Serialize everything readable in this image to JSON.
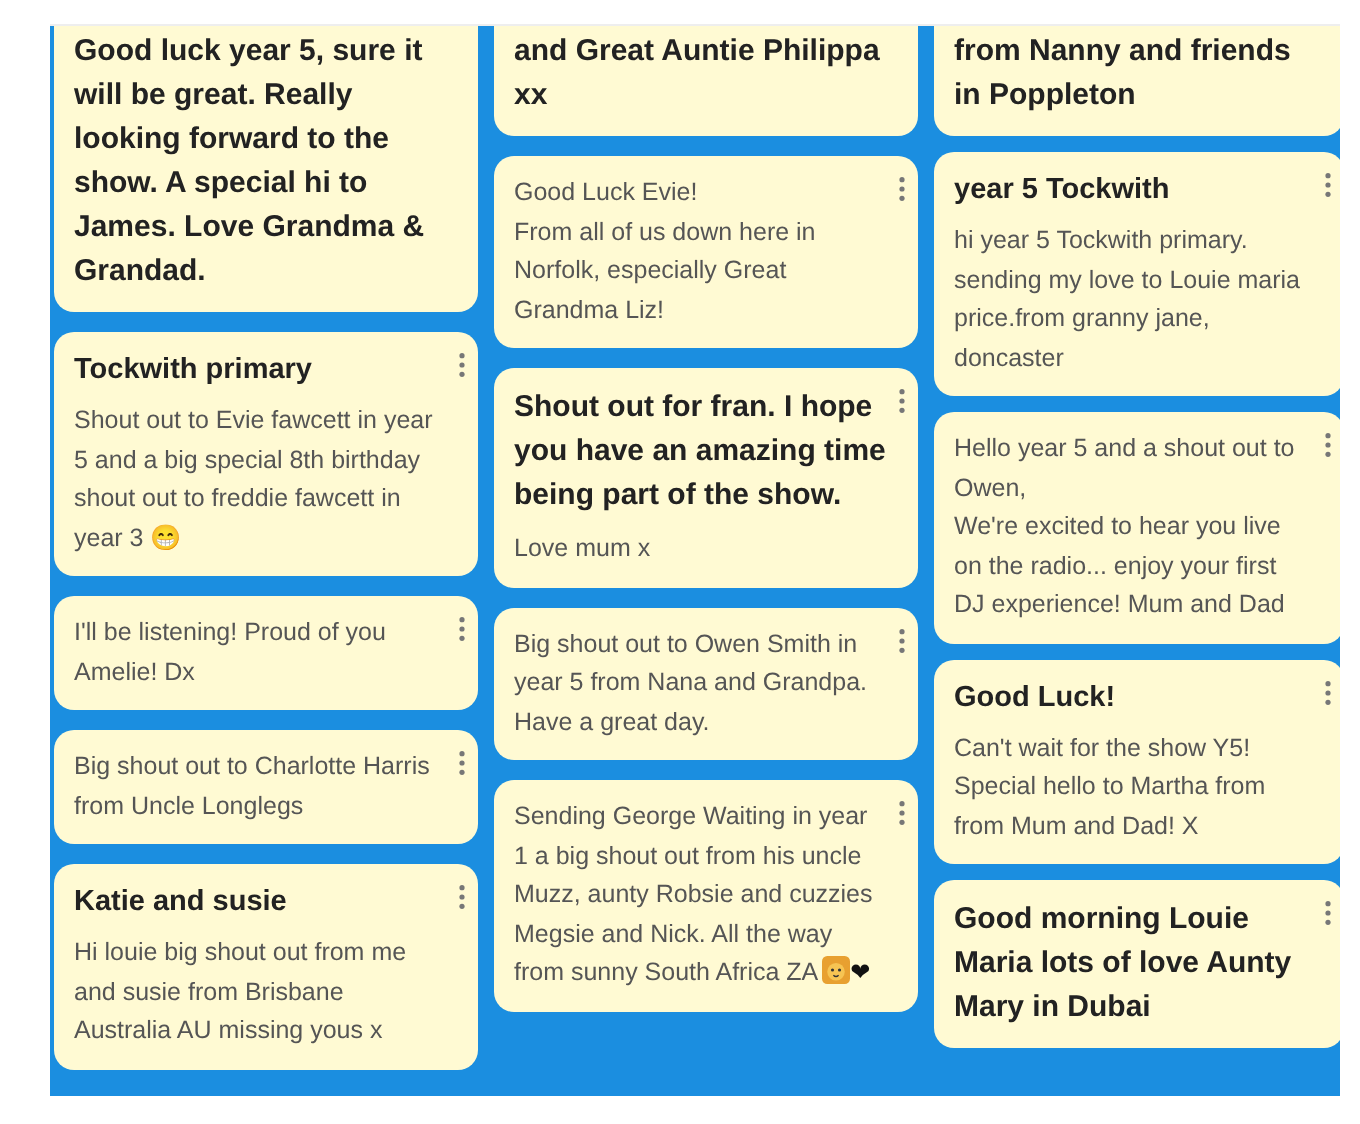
{
  "columns": [
    {
      "cards": [
        {
          "kind": "big",
          "text": "Good luck year 5, sure it will be great. Really looking forward to the show. A special hi to James. Love Grandma & Grandad."
        },
        {
          "kind": "titled",
          "title": "Tockwith primary",
          "body": "Shout out to Evie fawcett in year 5 and a big special 8th birthday shout out to freddie fawcett in year 3 😁"
        },
        {
          "kind": "plain",
          "body": "I'll be listening! Proud of you Amelie! Dx"
        },
        {
          "kind": "plain",
          "body": "Big shout out to Charlotte Harris from Uncle Longlegs"
        },
        {
          "kind": "titled",
          "title": "Katie and susie",
          "body": "Hi louie big shout out from me and susie from Brisbane Australia AU missing yous x"
        }
      ]
    },
    {
      "cards": [
        {
          "kind": "big",
          "text": "and Great Auntie Philippa xx"
        },
        {
          "kind": "plain",
          "body": "Good Luck Evie!\nFrom all of us down here in Norfolk, especially Great Grandma Liz!"
        },
        {
          "kind": "titled",
          "title": "Shout out for fran. I hope you have an amazing time being part of the show.",
          "big_title": true,
          "body": "Love mum x"
        },
        {
          "kind": "plain",
          "body": "Big shout out to Owen Smith in year 5 from Nana and Grandpa. Have a great day."
        },
        {
          "kind": "plain",
          "body": "Sending George Waiting in year 1 a big shout out from his uncle Muzz, aunty Robsie and cuzzies Megsie and Nick. All the way from sunny South Africa ZA",
          "lion": true,
          "suffix": "❤"
        }
      ]
    },
    {
      "cards": [
        {
          "kind": "big",
          "text": "from Nanny and friends in Poppleton"
        },
        {
          "kind": "titled",
          "title": "year 5 Tockwith",
          "body": "hi year 5 Tockwith primary. sending my love to Louie maria price.from granny jane, doncaster"
        },
        {
          "kind": "plain",
          "body": "Hello year 5 and a shout out to Owen,\nWe're excited to hear you live on the radio... enjoy your first DJ experience! Mum and Dad"
        },
        {
          "kind": "titled",
          "title": "Good Luck!",
          "body": "Can't wait for the show Y5! Special hello to Martha from from Mum and Dad! X"
        },
        {
          "kind": "big",
          "text": "Good morning Louie Maria lots of love Aunty Mary in Dubai"
        }
      ]
    }
  ]
}
